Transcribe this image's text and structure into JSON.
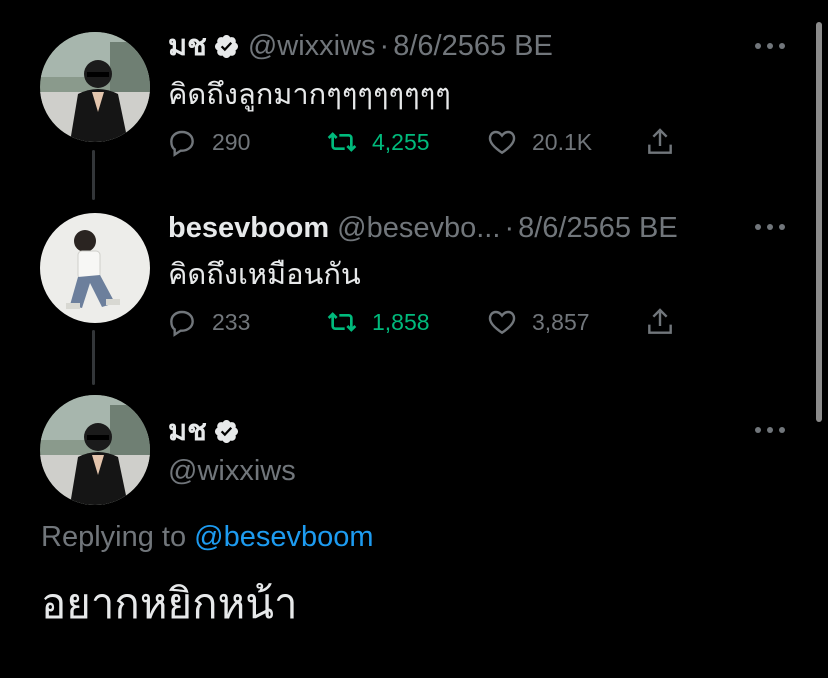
{
  "tweets": [
    {
      "name": "มช",
      "handle": "@wixxiws",
      "separator": "·",
      "date": "8/6/2565 BE",
      "text": "คิดถึงลูกมากๆๆๆๆๆๆๆๆ",
      "verified": true,
      "stats": {
        "replies": "290",
        "retweets": "4,255",
        "likes": "20.1K"
      }
    },
    {
      "name": "besevboom",
      "handle": "@besevbo...",
      "separator": "·",
      "date": "8/6/2565 BE",
      "text": "คิดถึงเหมือนกัน",
      "verified": false,
      "stats": {
        "replies": "233",
        "retweets": "1,858",
        "likes": "3,857"
      }
    }
  ],
  "focused_tweet": {
    "name": "มช",
    "handle": "@wixxiws",
    "verified": true,
    "replying_prefix": "Replying to",
    "replying_mention": "@besevboom",
    "text": "อยากหยิกหน้า"
  },
  "colors": {
    "background": "#000000",
    "text": "#e7e9ea",
    "muted": "#71767b",
    "retweet": "#00ba7c",
    "link": "#1d9bf0"
  },
  "icons": [
    "reply-icon",
    "retweet-icon",
    "like-icon",
    "share-icon",
    "more-icon",
    "verified-badge-icon"
  ]
}
